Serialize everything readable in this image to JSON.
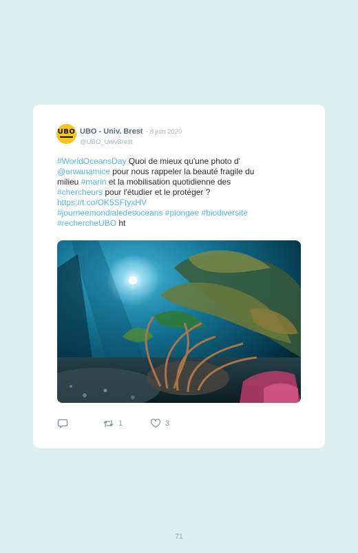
{
  "tweet": {
    "author": {
      "name": "UBO - Univ. Brest",
      "date": "· 8 juin 2020",
      "handle": "@UBO_UnivBrest",
      "avatar_logo": "UBO",
      "avatar_color": "#f7c51e"
    },
    "lines": [
      [
        {
          "t": "#WorldOceansDay",
          "link": true
        },
        {
          "t": " Quoi de mieux qu'une photo d'",
          "link": false
        }
      ],
      [
        {
          "t": "@erwanamice",
          "link": true
        },
        {
          "t": " pour nous rappeler la beauté fragile du",
          "link": false
        }
      ],
      [
        {
          "t": "milieu ",
          "link": false
        },
        {
          "t": "#marin",
          "link": true
        },
        {
          "t": " et la mobilisation quotidienne des",
          "link": false
        }
      ],
      [
        {
          "t": "#chercheurs",
          "link": true
        },
        {
          "t": " pour l'étudier et le protéger ?",
          "link": false
        }
      ],
      [
        {
          "t": "https://t.co/OK5SFtyxHV",
          "link": true
        }
      ],
      [
        {
          "t": "#journeemondialedesoceans",
          "link": true
        },
        {
          "t": " ",
          "link": false
        },
        {
          "t": "#plongee",
          "link": true
        },
        {
          "t": " ",
          "link": false
        },
        {
          "t": "#biodiversite",
          "link": true
        }
      ],
      [
        {
          "t": "#rechercheUBO",
          "link": true
        },
        {
          "t": " ht",
          "link": false
        }
      ]
    ],
    "image": {
      "subject": "underwater kelp forest with a diver"
    },
    "actions": {
      "reply": {
        "icon": "reply-icon"
      },
      "retweet": {
        "icon": "retweet-icon",
        "count": "1"
      },
      "like": {
        "icon": "heart-icon",
        "count": "3"
      }
    },
    "link_color": "#56b5e0"
  },
  "page": {
    "number": "71"
  }
}
